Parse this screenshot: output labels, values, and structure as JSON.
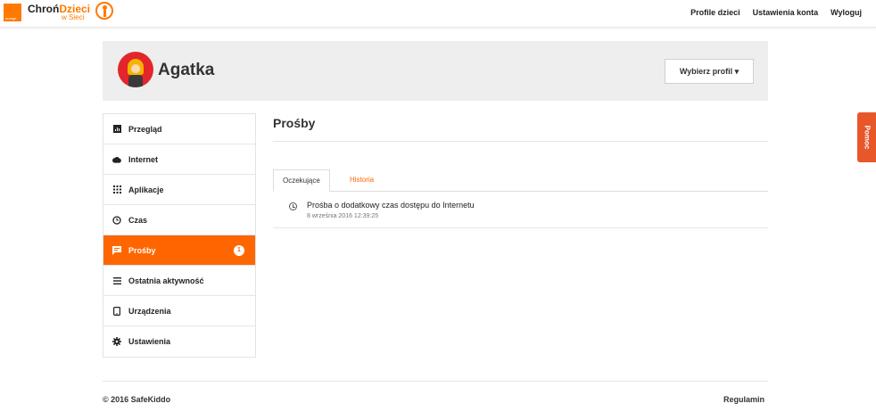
{
  "brand": {
    "name_part1": "Chroń",
    "name_part2": "Dzieci",
    "sub": "w Sieci",
    "orange_tag": "orange"
  },
  "nav": {
    "profiles": "Profile dzieci",
    "settings": "Ustawienia konta",
    "logout": "Wyloguj"
  },
  "profile": {
    "name": "Agatka",
    "choose_label": "Wybierz profil ▾"
  },
  "sidebar": {
    "items": [
      {
        "label": "Przegląd",
        "icon": "overview-icon"
      },
      {
        "label": "Internet",
        "icon": "cloud-icon"
      },
      {
        "label": "Aplikacje",
        "icon": "apps-grid-icon"
      },
      {
        "label": "Czas",
        "icon": "clock-icon"
      },
      {
        "label": "Prośby",
        "icon": "message-icon",
        "badge": "1",
        "active": true
      },
      {
        "label": "Ostatnia aktywność",
        "icon": "list-icon"
      },
      {
        "label": "Urządzenia",
        "icon": "phone-icon"
      },
      {
        "label": "Ustawienia",
        "icon": "gear-icon"
      }
    ]
  },
  "main": {
    "title": "Prośby",
    "tabs": [
      {
        "label": "Oczekujące"
      },
      {
        "label": "Historia"
      }
    ],
    "requests": [
      {
        "title": "Prośba o dodatkowy czas dostępu do Internetu",
        "date": "8 września 2016 12:39:25"
      }
    ]
  },
  "footer": {
    "copyright": "© 2016 SafeKiddo",
    "terms": "Regulamin"
  },
  "help": {
    "label": "Pomoc"
  },
  "colors": {
    "accent": "#ff6600",
    "brand_orange": "#ff7900",
    "help_tab": "#e8572a"
  }
}
